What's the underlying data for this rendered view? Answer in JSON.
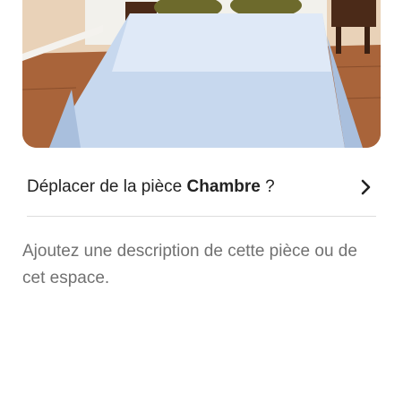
{
  "photo": {
    "alt": "Chambre",
    "icon": "room-photo"
  },
  "move_row": {
    "prefix": "Déplacer de la pièce ",
    "room_name": "Chambre",
    "suffix": " ?",
    "icon": "chevron-right-icon"
  },
  "description_placeholder": "Ajoutez une description de cette pièce ou de cet espace.",
  "colors": {
    "text_primary": "#222222",
    "text_secondary": "#717171",
    "divider": "#dddddd",
    "background": "#ffffff"
  }
}
